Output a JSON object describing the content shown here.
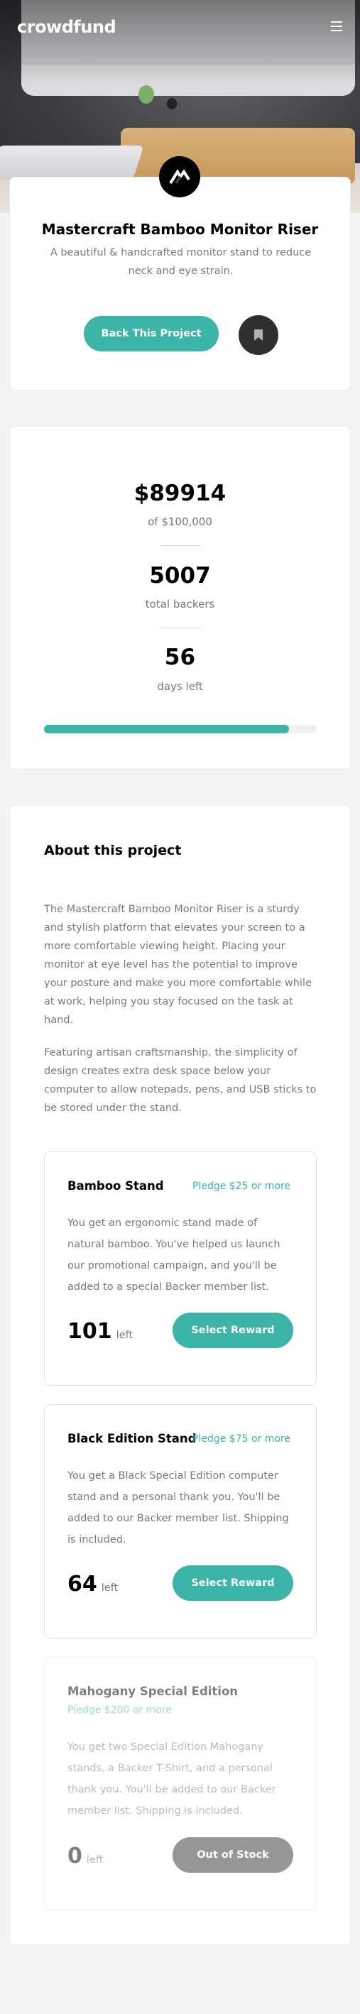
{
  "header": {
    "logo": "crowdfund",
    "menu_icon": "hamburger-icon"
  },
  "intro": {
    "title": "Mastercraft Bamboo Monitor Riser",
    "subtitle": "A beautiful & handcrafted monitor stand to reduce neck and eye strain.",
    "back_button": "Back This Project",
    "bookmark_icon": "bookmark-icon"
  },
  "stats": {
    "raised": "$89914",
    "raised_label": "of $100,000",
    "backers": "5007",
    "backers_label": "total backers",
    "days": "56",
    "days_label": "days left",
    "progress_fraction": 0.89914,
    "accent_color": "#3cb4a7"
  },
  "about": {
    "heading": "About this project",
    "paragraph1": "The Mastercraft Bamboo Monitor Riser is a sturdy and stylish platform that elevates your screen to a more comfortable viewing height. Placing your monitor at eye level has the potential to improve your posture and make you more comfortable while at work, helping you stay focused on the task at hand.",
    "paragraph2": "Featuring artisan craftsmanship, the simplicity of design creates extra desk space below your computer to allow notepads, pens, and USB sticks to be stored under the stand."
  },
  "rewards": [
    {
      "name": "Bamboo Stand",
      "pledge": "Pledge $25 or more",
      "description": "You get an ergonomic stand made of natural bamboo. You've helped us launch our promotional campaign, and you'll be added to a special Backer member list.",
      "left_count": "101",
      "left_label": "left",
      "button": "Select Reward"
    },
    {
      "name": "Black Edition Stand",
      "pledge": "Pledge $75 or more",
      "description": "You get a Black Special Edition computer stand and a personal thank you. You'll be added to our Backer member list. Shipping is included.",
      "left_count": "64",
      "left_label": "left",
      "button": "Select Reward"
    },
    {
      "name": "Mahogany Special Edition",
      "pledge": "Pledge $200 or more",
      "description": "You get two Special Edition Mahogany stands, a Backer T-Shirt, and a personal thank you. You'll be added to our Backer member list. Shipping is included.",
      "left_count": "0",
      "left_label": "left",
      "button": "Out of Stock"
    }
  ]
}
